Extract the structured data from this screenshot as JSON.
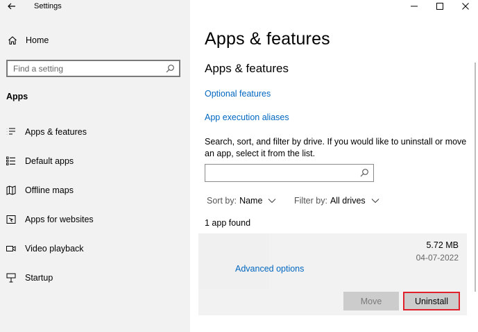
{
  "window": {
    "title": "Settings",
    "controls": [
      "minimize",
      "maximize",
      "close"
    ]
  },
  "sidebar": {
    "home_label": "Home",
    "search_placeholder": "Find a setting",
    "section_label": "Apps",
    "items": [
      {
        "label": "Apps & features",
        "icon": "list-icon"
      },
      {
        "label": "Default apps",
        "icon": "default-apps-icon"
      },
      {
        "label": "Offline maps",
        "icon": "map-icon"
      },
      {
        "label": "Apps for websites",
        "icon": "web-apps-icon"
      },
      {
        "label": "Video playback",
        "icon": "video-icon"
      },
      {
        "label": "Startup",
        "icon": "startup-icon"
      }
    ]
  },
  "main": {
    "page_title": "Apps & features",
    "sub_title": "Apps & features",
    "links": {
      "optional_features": "Optional features",
      "execution_aliases": "App execution aliases"
    },
    "description": "Search, sort, and filter by drive. If you would like to uninstall or move an app, select it from the list.",
    "filter_value": "",
    "sort": {
      "label": "Sort by:",
      "value": "Name"
    },
    "filter": {
      "label": "Filter by:",
      "value": "All drives"
    },
    "count_text": "1 app found",
    "app": {
      "size": "5.72 MB",
      "date": "04-07-2022",
      "advanced_label": "Advanced options",
      "move_label": "Move",
      "uninstall_label": "Uninstall"
    }
  },
  "colors": {
    "link": "#0067c0",
    "sidebar_bg": "#f2f2f2",
    "highlight": "#e0202a"
  }
}
